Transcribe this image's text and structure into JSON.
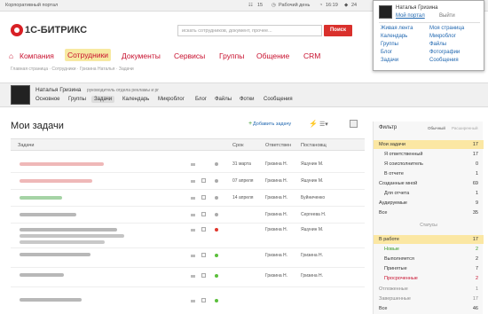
{
  "topbar": {
    "portal": "Корпоративный портал",
    "counter": "15",
    "status": "Рабочий день",
    "time": "16:19",
    "bell": "24"
  },
  "logo": {
    "text": "1С-БИТРИКС"
  },
  "search": {
    "placeholder": "искать сотрудников, документ, прочее...",
    "button": "Поиск"
  },
  "nav": [
    "Компания",
    "Сотрудники",
    "Документы",
    "Сервисы",
    "Группы",
    "Общение",
    "CRM"
  ],
  "breadcrumbs": "Главная страница  ·  Сотрудники  ·  Гризина Наталья  ·  Задачи",
  "profile": {
    "name": "Наталья Гризина",
    "role": "руководитель отдела рекламы и рг"
  },
  "subnav": [
    "Основное",
    "Группы",
    "Задачи",
    "Календарь",
    "Микроблог",
    "Блог",
    "Файлы",
    "Фотки",
    "Сообщения"
  ],
  "page_title": "Мои задачи",
  "add_task": "Добавить задачу",
  "grid_headers": {
    "task": "Задачи",
    "deadline": "Срок",
    "responsible": "Ответствен",
    "creator": "Постановщ"
  },
  "rows": [
    {
      "deadline": "31 марта",
      "responsible": "Гризина Н.",
      "creator": "Яшунин М.",
      "blur_color": "#e89a9a",
      "status_color": "#aaaaaa"
    },
    {
      "deadline": "07 апреля",
      "responsible": "Гризина Н.",
      "creator": "Яшунин М.",
      "blur_color": "#e89a9a",
      "status_color": "#aaaaaa"
    },
    {
      "deadline": "14 апреля",
      "responsible": "Гризина Н.",
      "creator": "Буйниченко",
      "blur_color": "#8fc88f",
      "status_color": "#aaaaaa"
    },
    {
      "deadline": "",
      "responsible": "Гризина Н.",
      "creator": "Сергеева Н.",
      "blur_color": "#b8b8b8",
      "status_color": "#aaaaaa"
    },
    {
      "deadline": "",
      "responsible": "Гризина Н.",
      "creator": "Яшунин М.",
      "blur_color": "#b8b8b8",
      "status_color": "#e0382d"
    },
    {
      "deadline": "",
      "responsible": "Гризина Н.",
      "creator": "Гризина Н.",
      "blur_color": "#b8b8b8",
      "status_color": "#5bbf3c"
    },
    {
      "deadline": "",
      "responsible": "Гризина Н.",
      "creator": "Гризина Н.",
      "blur_color": "#b8b8b8",
      "status_color": "#5bbf3c"
    }
  ],
  "filter": {
    "title": "Фильтр",
    "mode_normal": "Обычный",
    "mode_extended": "Расширенный",
    "items": [
      {
        "label": "Мои задачи",
        "count": "17"
      },
      {
        "label": "Я ответственный",
        "count": "17"
      },
      {
        "label": "Я соисполнитель",
        "count": "0"
      },
      {
        "label": "В отчете",
        "count": "1"
      },
      {
        "label": "Созданные мной",
        "count": "69"
      },
      {
        "label": "Для отчета",
        "count": "1"
      },
      {
        "label": "Аудируемые",
        "count": "9"
      },
      {
        "label": "Все",
        "count": "35"
      }
    ],
    "status_title": "Статусы",
    "statuses": [
      {
        "label": "В работе",
        "count": "17"
      },
      {
        "label": "Новые",
        "count": "2"
      },
      {
        "label": "Выполняется",
        "count": "2"
      },
      {
        "label": "Принятые",
        "count": "7"
      },
      {
        "label": "Просроченные",
        "count": "2"
      },
      {
        "label": "Отложенные",
        "count": "1"
      },
      {
        "label": "Завершенные",
        "count": "17"
      },
      {
        "label": "Все",
        "count": "46"
      }
    ]
  },
  "popup": {
    "name": "Наталья Гризина",
    "my_portal": "Мой портал",
    "logout": "Выйти",
    "col1": [
      "Живая лента",
      "Календарь",
      "Группы",
      "Блог",
      "Задачи"
    ],
    "col2": [
      "Моя страница",
      "Микроблог",
      "Файлы",
      "Фотографии",
      "Сообщения"
    ]
  },
  "colors": {
    "accent": "#c8102e",
    "active_nav": "#f7e9a2",
    "link": "#2067b0",
    "filter_active": "#fbe7a3"
  }
}
